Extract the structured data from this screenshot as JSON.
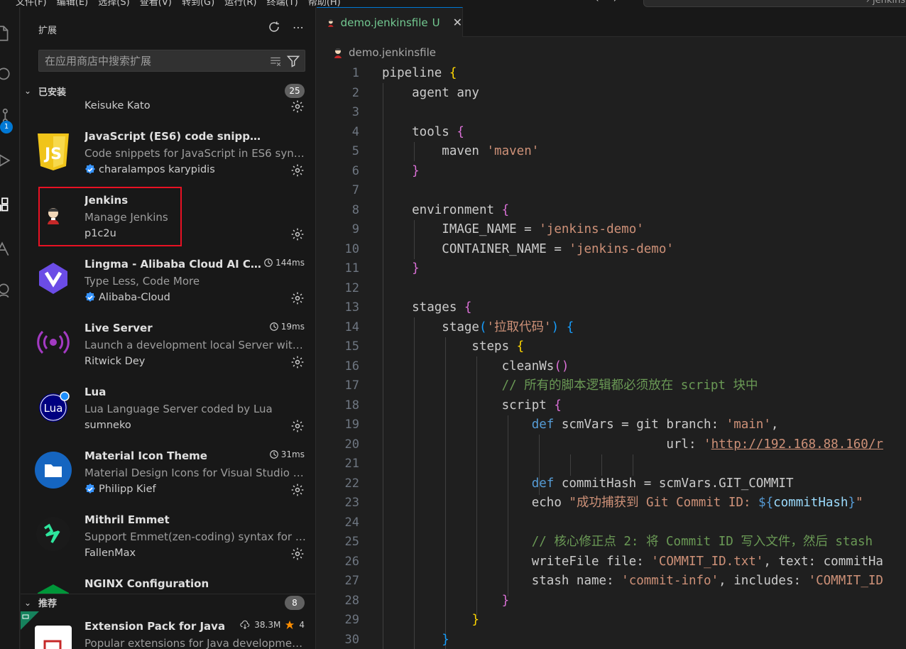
{
  "menubar": {
    "items": "文件(F)  编辑(E)  选择(S)  查看(V)  转到(G)  运行(R)  终端(T)  帮助(H)",
    "search_tail": "jenkins"
  },
  "activity": {
    "scm_badge": "1"
  },
  "sidebar": {
    "title": "扩展",
    "search_placeholder": "在应用商店中搜索扩展",
    "installed": {
      "label": "已安装",
      "count": "25"
    },
    "recommended": {
      "label": "推荐",
      "count": "8"
    },
    "items": [
      {
        "name": "",
        "desc": "",
        "publisher": "Keisuke Kato",
        "verified": false,
        "time": ""
      },
      {
        "name": "JavaScript (ES6) code snippets",
        "desc": "Code snippets for JavaScript in ES6 syntax",
        "publisher": "charalampos karypidis",
        "verified": true,
        "time": ""
      },
      {
        "name": "Jenkins",
        "desc": "Manage Jenkins",
        "publisher": "p1c2u",
        "verified": false,
        "time": ""
      },
      {
        "name": "Lingma - Alibaba Cloud AI Cod...",
        "desc": "Type Less, Code More",
        "publisher": "Alibaba-Cloud",
        "verified": true,
        "time": "144ms"
      },
      {
        "name": "Live Server",
        "desc": "Launch a development local Server with li...",
        "publisher": "Ritwick Dey",
        "verified": false,
        "time": "19ms"
      },
      {
        "name": "Lua",
        "desc": "Lua Language Server coded by Lua",
        "publisher": "sumneko",
        "verified": false,
        "time": ""
      },
      {
        "name": "Material Icon Theme",
        "desc": "Material Design Icons for Visual Studio Co...",
        "publisher": "Philipp Kief",
        "verified": true,
        "time": "31ms"
      },
      {
        "name": "Mithril Emmet",
        "desc": "Support Emmet(zen-coding) syntax for Mi...",
        "publisher": "FallenMax",
        "verified": false,
        "time": ""
      },
      {
        "name": "NGINX Configuration",
        "desc": "",
        "publisher": "",
        "verified": false,
        "time": ""
      }
    ],
    "rec_item": {
      "name": "Extension Pack for Java",
      "desc": "Popular extensions for Java development ...",
      "downloads": "38.3M",
      "rating": "4"
    },
    "lua_logo_text": "Lua",
    "js_logo_text": "JS"
  },
  "editor": {
    "tab": {
      "name": "demo.jenkinsfile",
      "status": "U",
      "close": "✕"
    },
    "breadcrumb": "demo.jenkinsfile",
    "lines": [
      "pipeline {",
      "    agent any",
      "",
      "    tools {",
      "        maven 'maven'",
      "    }",
      "",
      "    environment {",
      "        IMAGE_NAME = 'jenkins-demo'",
      "        CONTAINER_NAME = 'jenkins-demo'",
      "    }",
      "",
      "    stages {",
      "        stage('拉取代码') {",
      "            steps {",
      "                cleanWs()",
      "                // 所有的脚本逻辑都必须放在 script 块中",
      "                script {",
      "                    def scmVars = git branch: 'main',",
      "                                      url: 'http://192.168.88.160/r",
      "",
      "                    def commitHash = scmVars.GIT_COMMIT",
      "                    echo \"成功捕获到 Git Commit ID: ${commitHash}\"",
      "",
      "                    // 核心修正点 2: 将 Commit ID 写入文件，然后 stash",
      "                    writeFile file: 'COMMIT_ID.txt', text: commitHa",
      "                    stash name: 'commit-info', includes: 'COMMIT_ID",
      "                }",
      "            }",
      "        }"
    ]
  }
}
